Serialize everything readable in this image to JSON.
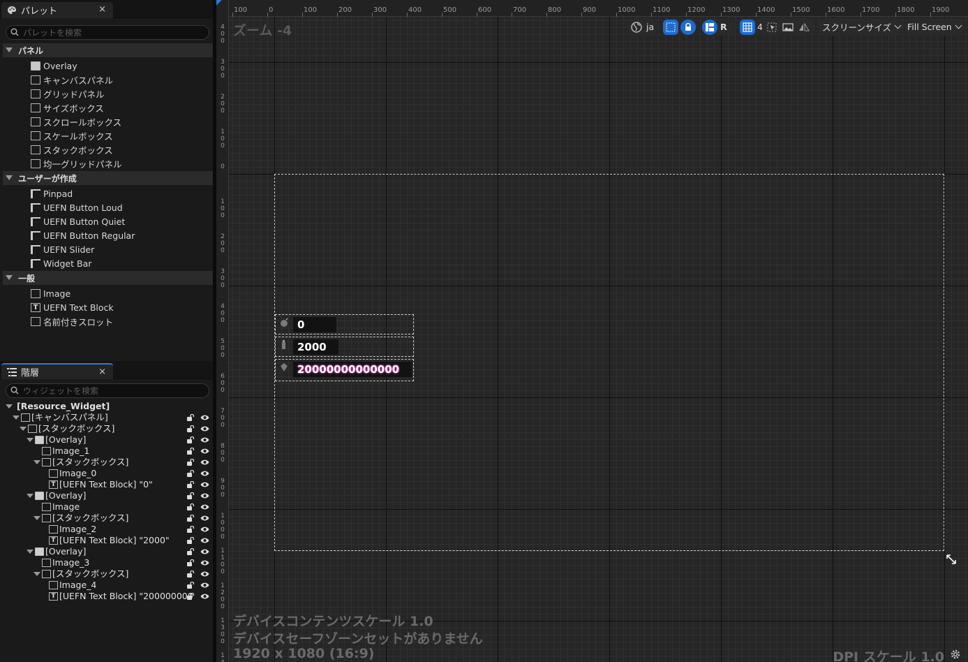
{
  "palette": {
    "tab_label": "パレット",
    "close": "×",
    "search_placeholder": "パレットを検索",
    "categories": [
      {
        "label": "パネル",
        "items": [
          "Overlay",
          "キャンバスパネル",
          "グリッドパネル",
          "サイズボックス",
          "スクロールボックス",
          "スケールボックス",
          "スタックボックス",
          "均一グリッドパネル"
        ]
      },
      {
        "label": "ユーザーが作成",
        "items": [
          "Pinpad",
          "UEFN Button Loud",
          "UEFN Button Quiet",
          "UEFN Button Regular",
          "UEFN Slider",
          "Widget Bar"
        ]
      },
      {
        "label": "一般",
        "items": [
          "Image",
          "UEFN Text Block",
          "名前付きスロット"
        ]
      }
    ]
  },
  "hierarchy": {
    "tab_label": "階層",
    "close": "×",
    "search_placeholder": "ウィジェットを検索",
    "rows": [
      {
        "label": "[Resource_Widget]",
        "depth": 0,
        "arrow": true,
        "icon": "none",
        "controls": false
      },
      {
        "label": "[キャンバスパネル]",
        "depth": 1,
        "arrow": true,
        "icon": "canvas-panel-icon",
        "controls": true
      },
      {
        "label": "[スタックボックス]",
        "depth": 2,
        "arrow": true,
        "icon": "stack-box-icon",
        "controls": true
      },
      {
        "label": "[Overlay]",
        "depth": 3,
        "arrow": true,
        "icon": "overlay-icon",
        "controls": true
      },
      {
        "label": "Image_1",
        "depth": 4,
        "arrow": false,
        "icon": "image-icon",
        "controls": true
      },
      {
        "label": "[スタックボックス]",
        "depth": 4,
        "arrow": true,
        "icon": "stack-box-icon",
        "controls": true
      },
      {
        "label": "Image_0",
        "depth": 5,
        "arrow": false,
        "icon": "image-icon",
        "controls": true
      },
      {
        "label": "[UEFN Text Block] \"0\"",
        "depth": 5,
        "arrow": false,
        "icon": "text-icon",
        "controls": true
      },
      {
        "label": "[Overlay]",
        "depth": 3,
        "arrow": true,
        "icon": "overlay-icon",
        "controls": true
      },
      {
        "label": "Image",
        "depth": 4,
        "arrow": false,
        "icon": "image-icon",
        "controls": true
      },
      {
        "label": "[スタックボックス]",
        "depth": 4,
        "arrow": true,
        "icon": "stack-box-icon",
        "controls": true
      },
      {
        "label": "Image_2",
        "depth": 5,
        "arrow": false,
        "icon": "image-icon",
        "controls": true
      },
      {
        "label": "[UEFN Text Block] \"2000\"",
        "depth": 5,
        "arrow": false,
        "icon": "text-icon",
        "controls": true
      },
      {
        "label": "[Overlay]",
        "depth": 3,
        "arrow": true,
        "icon": "overlay-icon",
        "controls": true
      },
      {
        "label": "Image_3",
        "depth": 4,
        "arrow": false,
        "icon": "image-icon",
        "controls": true
      },
      {
        "label": "[スタックボックス]",
        "depth": 4,
        "arrow": true,
        "icon": "stack-box-icon",
        "controls": true
      },
      {
        "label": "Image_4",
        "depth": 5,
        "arrow": false,
        "icon": "image-icon",
        "controls": true
      },
      {
        "label": "[UEFN Text Block] \"200000000",
        "depth": 5,
        "arrow": false,
        "icon": "text-icon",
        "controls": true
      }
    ]
  },
  "designer": {
    "zoom_label": "ズーム -4",
    "ruler_top": [
      "100",
      "0",
      "100",
      "200",
      "300",
      "400",
      "500",
      "600",
      "700",
      "800",
      "900",
      "1000",
      "1100",
      "1200",
      "1300",
      "1400",
      "1500",
      "1600",
      "1700",
      "1800",
      "1900"
    ],
    "ruler_left": [
      "400",
      "300",
      "200",
      "100",
      "0",
      "100",
      "200",
      "300",
      "400",
      "500",
      "600",
      "700",
      "800",
      "900",
      "1000",
      "1100",
      "1200",
      "1300",
      "1400"
    ],
    "toolbar": {
      "lang": "ja",
      "r_label": "R",
      "grid_value": "4",
      "screen_size": "スクリーンサイズ",
      "fill_screen": "Fill Screen"
    },
    "resources": [
      "0",
      "2000",
      "20000000000000"
    ],
    "overlay_lines": [
      "デバイスコンテンツスケール 1.0",
      "デバイスセーフゾーンセットがありません",
      "1920 x 1080 (16:9)"
    ],
    "dpi_label": "DPI スケール 1.0"
  },
  "colors": {
    "accent": "#1d6cd0",
    "panel_bg": "#1a1a1a",
    "canvas_bg": "#262626"
  }
}
